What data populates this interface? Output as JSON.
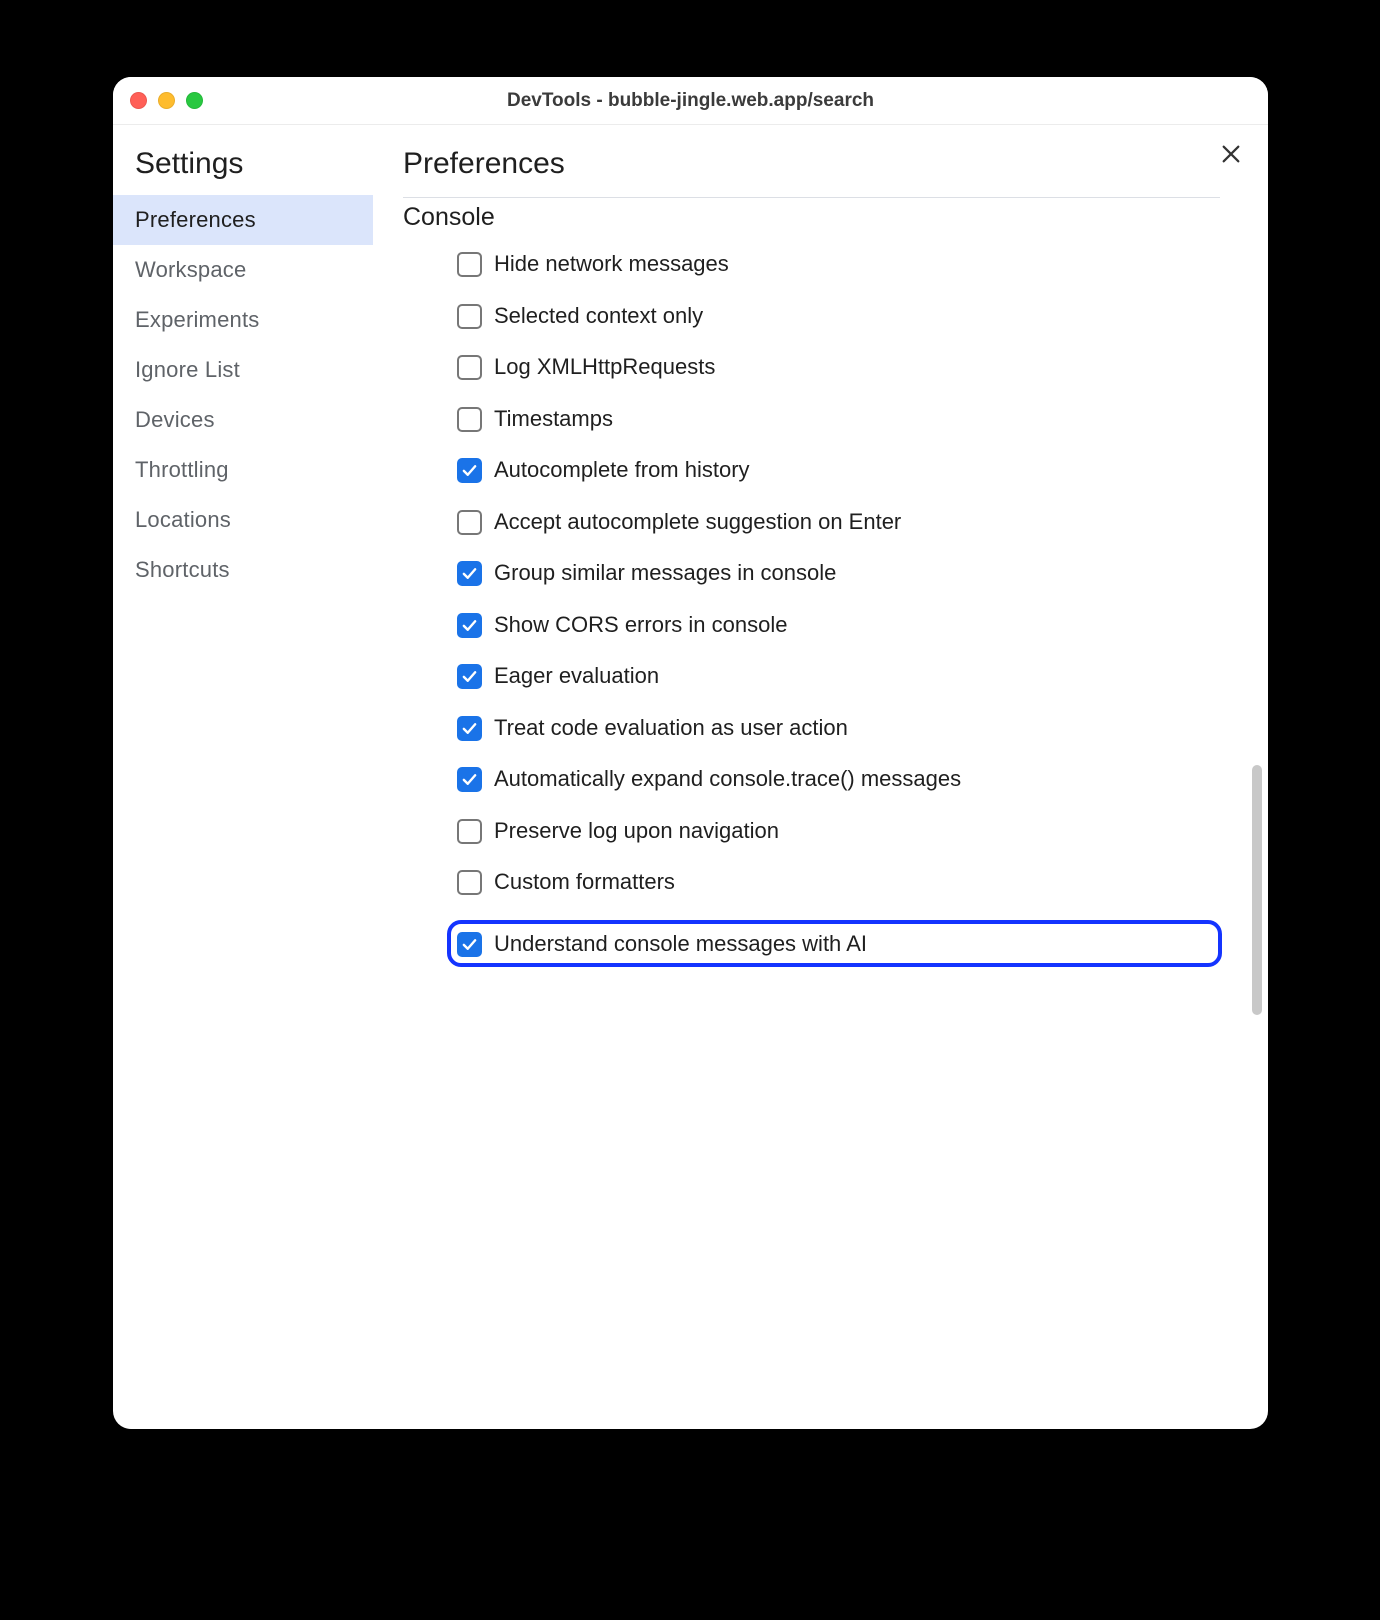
{
  "window": {
    "title": "DevTools - bubble-jingle.web.app/search"
  },
  "sidebar": {
    "title": "Settings",
    "items": [
      {
        "label": "Preferences",
        "active": true,
        "name": "sidebar-item-preferences"
      },
      {
        "label": "Workspace",
        "active": false,
        "name": "sidebar-item-workspace"
      },
      {
        "label": "Experiments",
        "active": false,
        "name": "sidebar-item-experiments"
      },
      {
        "label": "Ignore List",
        "active": false,
        "name": "sidebar-item-ignore-list"
      },
      {
        "label": "Devices",
        "active": false,
        "name": "sidebar-item-devices"
      },
      {
        "label": "Throttling",
        "active": false,
        "name": "sidebar-item-throttling"
      },
      {
        "label": "Locations",
        "active": false,
        "name": "sidebar-item-locations"
      },
      {
        "label": "Shortcuts",
        "active": false,
        "name": "sidebar-item-shortcuts"
      }
    ]
  },
  "main": {
    "title": "Preferences",
    "section": {
      "title": "Console",
      "options": [
        {
          "label": "Hide network messages",
          "checked": false,
          "highlight": false,
          "name": "opt-hide-network-messages"
        },
        {
          "label": "Selected context only",
          "checked": false,
          "highlight": false,
          "name": "opt-selected-context-only"
        },
        {
          "label": "Log XMLHttpRequests",
          "checked": false,
          "highlight": false,
          "name": "opt-log-xmlhttprequests"
        },
        {
          "label": "Timestamps",
          "checked": false,
          "highlight": false,
          "name": "opt-timestamps"
        },
        {
          "label": "Autocomplete from history",
          "checked": true,
          "highlight": false,
          "name": "opt-autocomplete-from-history"
        },
        {
          "label": "Accept autocomplete suggestion on Enter",
          "checked": false,
          "highlight": false,
          "name": "opt-accept-autocomplete-on-enter"
        },
        {
          "label": "Group similar messages in console",
          "checked": true,
          "highlight": false,
          "name": "opt-group-similar-messages"
        },
        {
          "label": "Show CORS errors in console",
          "checked": true,
          "highlight": false,
          "name": "opt-show-cors-errors"
        },
        {
          "label": "Eager evaluation",
          "checked": true,
          "highlight": false,
          "name": "opt-eager-evaluation"
        },
        {
          "label": "Treat code evaluation as user action",
          "checked": true,
          "highlight": false,
          "name": "opt-treat-code-eval-user-action"
        },
        {
          "label": "Automatically expand console.trace() messages",
          "checked": true,
          "highlight": false,
          "name": "opt-auto-expand-trace"
        },
        {
          "label": "Preserve log upon navigation",
          "checked": false,
          "highlight": false,
          "name": "opt-preserve-log"
        },
        {
          "label": "Custom formatters",
          "checked": false,
          "highlight": false,
          "name": "opt-custom-formatters"
        },
        {
          "label": "Understand console messages with AI",
          "checked": true,
          "highlight": true,
          "name": "opt-understand-with-ai"
        }
      ]
    }
  }
}
